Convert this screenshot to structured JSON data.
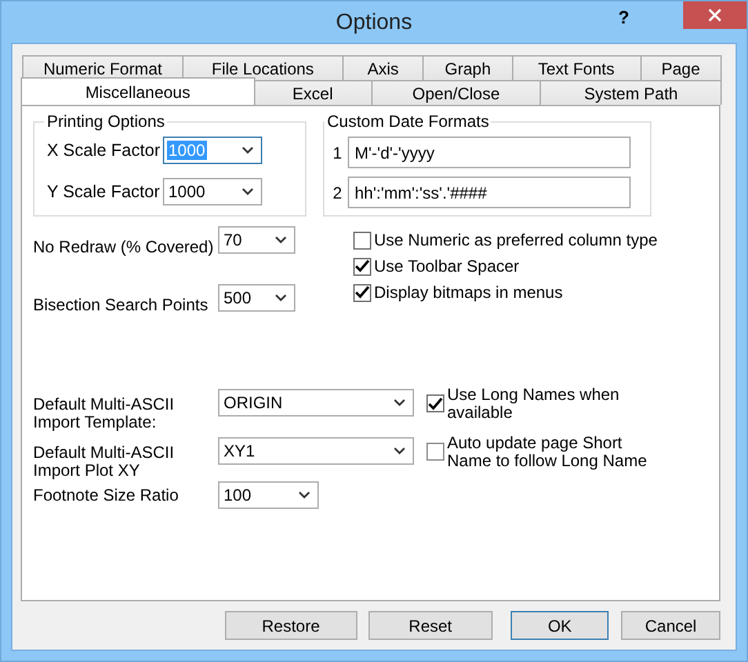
{
  "window": {
    "title": "Options",
    "help": "?"
  },
  "tab_rows": [
    [
      {
        "label": "Numeric Format",
        "selected": false
      },
      {
        "label": "File Locations",
        "selected": false
      },
      {
        "label": "Axis",
        "selected": false
      },
      {
        "label": "Graph",
        "selected": false
      },
      {
        "label": "Text Fonts",
        "selected": false
      },
      {
        "label": "Page",
        "selected": false
      }
    ],
    [
      {
        "label": "Miscellaneous",
        "selected": true
      },
      {
        "label": "Excel",
        "selected": false
      },
      {
        "label": "Open/Close",
        "selected": false
      },
      {
        "label": "System Path",
        "selected": false
      }
    ]
  ],
  "printing_options": {
    "title": "Printing Options",
    "fields": [
      {
        "label": "X Scale Factor",
        "value": "1000",
        "focused": true
      },
      {
        "label": "Y Scale Factor",
        "value": "1000",
        "focused": false
      }
    ]
  },
  "custom_date_formats": {
    "title": "Custom Date Formats",
    "items": [
      {
        "index": "1",
        "value": "M'-'d'-'yyyy"
      },
      {
        "index": "2",
        "value": "hh':'mm':'ss'.'####"
      }
    ]
  },
  "settings": [
    {
      "label": "No Redraw (% Covered)",
      "value": "70"
    },
    {
      "label": "Bisection Search Points",
      "value": "500"
    }
  ],
  "checkboxes": [
    {
      "label": "Use Numeric as preferred column type",
      "checked": false
    },
    {
      "label": "Use Toolbar Spacer",
      "checked": true
    },
    {
      "label": "Display bitmaps in menus",
      "checked": true
    }
  ],
  "import_rows": [
    {
      "label": "Default Multi-ASCII Import Template:",
      "value": "ORIGIN",
      "checkbox": {
        "label": "Use Long Names when available",
        "checked": true
      }
    },
    {
      "label": "Default Multi-ASCII Import Plot XY",
      "value": "XY1",
      "checkbox": {
        "label": "Auto update page Short Name to follow Long Name",
        "checked": false
      }
    }
  ],
  "footnote": {
    "label": "Footnote Size Ratio",
    "value": "100"
  },
  "buttons": [
    {
      "label": "Restore",
      "default": false
    },
    {
      "label": "Reset",
      "default": false
    },
    {
      "label": "OK",
      "default": true
    },
    {
      "label": "Cancel",
      "default": false
    }
  ]
}
